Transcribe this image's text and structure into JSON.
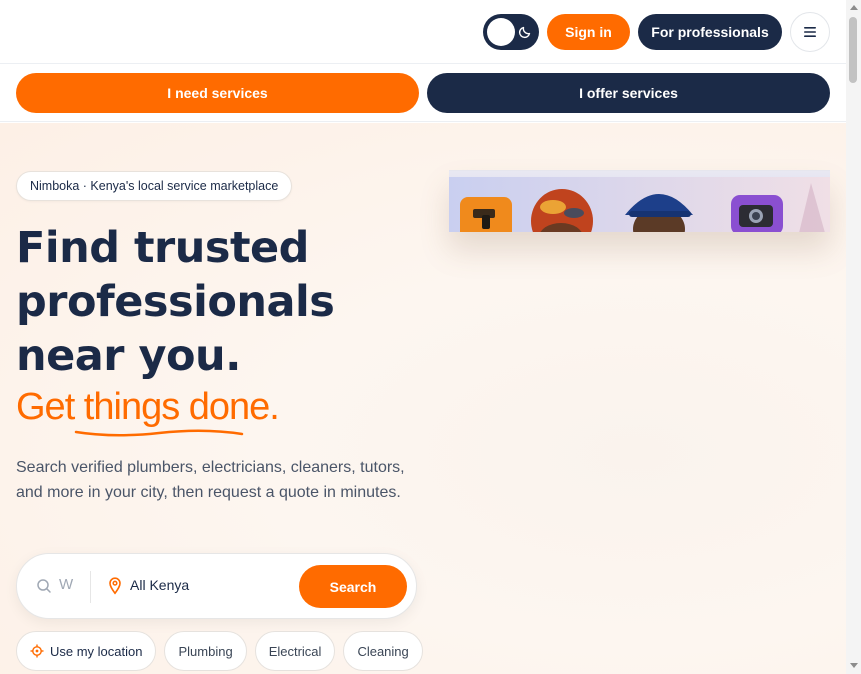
{
  "header": {
    "theme_toggle_icon": "moon-icon",
    "sign_in_label": "Sign in",
    "for_professionals_label": "For professionals",
    "menu_icon": "hamburger-menu-icon"
  },
  "mode_tabs": {
    "need_label": "I need services",
    "offer_label": "I offer services"
  },
  "hero": {
    "pill": "Nimboka · Kenya's local service marketplace",
    "headline_lines": [
      "Find trusted",
      "professionals",
      "near you."
    ],
    "tagline": "Get things done.",
    "description": "Search verified plumbers, electricians, cleaners, tutors, and more in your city, then request a quote in minutes."
  },
  "search": {
    "query_placeholder": "W",
    "location_value": "All Kenya",
    "button_label": "Search"
  },
  "chips": {
    "use_location": "Use my location",
    "items": [
      "Plumbing",
      "Electrical",
      "Cleaning"
    ]
  },
  "colors": {
    "brand_orange": "#ff6b00",
    "navy": "#1b2a47"
  }
}
